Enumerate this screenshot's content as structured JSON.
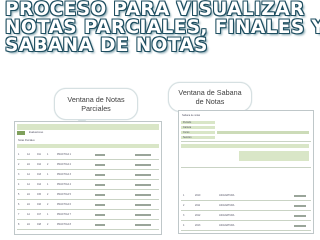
{
  "title": {
    "lines": [
      "Proceso para visualizar",
      "notas parciales, finales y",
      "sabana de notas"
    ]
  },
  "callouts": {
    "left": "Ventana de Notas Parciales",
    "right": "Ventana de Sabana de Notas"
  },
  "left_window": {
    "header_tab": "Evaluaciones",
    "section_label": "Notas Parciales",
    "columns": [
      "No.",
      "Codigo",
      "Sede",
      "Parcial",
      "Nota",
      "Evaluacion",
      "Fecha"
    ],
    "rows": [
      [
        "1",
        "1A",
        "011",
        "1",
        "PRACTICA 1"
      ],
      [
        "2",
        "2A",
        "012",
        "2",
        "PRACTICA 2"
      ],
      [
        "3",
        "1A",
        "013",
        "1",
        "PRACTICA 3"
      ],
      [
        "4",
        "1A",
        "014",
        "1",
        "PRACTICA 4"
      ],
      [
        "5",
        "2A",
        "015",
        "2",
        "PRACTICA 5"
      ],
      [
        "6",
        "2A",
        "016",
        "2",
        "PRACTICA 6"
      ],
      [
        "7",
        "1A",
        "017",
        "1",
        "PRACTICA 7"
      ],
      [
        "8",
        "2A",
        "018",
        "2",
        "PRACTICA 8"
      ]
    ]
  },
  "right_window": {
    "header_label": "Sabana de notas",
    "fields": [
      "Periodo",
      "Carrera",
      "Curso",
      "Seccion"
    ],
    "rows": [
      [
        "1",
        "2010",
        "ASIGNATURA"
      ],
      [
        "2",
        "2011",
        "ASIGNATURA"
      ],
      [
        "3",
        "2012",
        "ASIGNATURA"
      ],
      [
        "4",
        "2013",
        "ASIGNATURA"
      ]
    ]
  }
}
